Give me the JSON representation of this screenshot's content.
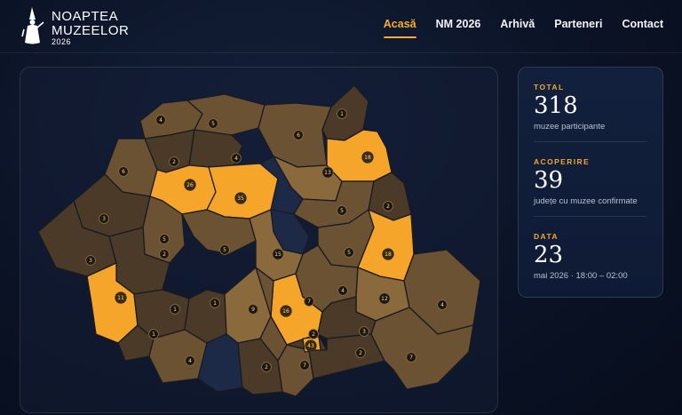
{
  "brand": {
    "line1": "NOAPTEA",
    "line2": "MUZEELOR",
    "year": "2026"
  },
  "nav": [
    {
      "label": "Acasă",
      "active": true
    },
    {
      "label": "NM 2026",
      "active": false
    },
    {
      "label": "Arhivă",
      "active": false
    },
    {
      "label": "Parteneri",
      "active": false
    },
    {
      "label": "Contact",
      "active": false
    }
  ],
  "stats": [
    {
      "label": "TOTAL",
      "value": "318",
      "desc": "muzee participante"
    },
    {
      "label": "ACOPERIRE",
      "value": "39",
      "desc": "județe cu muzee confirmate"
    },
    {
      "label": "DATA",
      "value": "23",
      "desc": "mai 2026 · 18:00 – 02:00"
    }
  ],
  "colors": {
    "accent": "#f6ad2d",
    "highlight": "#f5a62a",
    "low": "#4a3a27",
    "mid": "#6b5232",
    "high": "#8a6a3c"
  },
  "map": {
    "counties": [
      {
        "id": "SM",
        "count": "4",
        "tone": "mid"
      },
      {
        "id": "MM",
        "count": "5",
        "tone": "mid"
      },
      {
        "id": "SV",
        "count": "6",
        "tone": "mid"
      },
      {
        "id": "BT",
        "count": "1",
        "tone": "low"
      },
      {
        "id": "BH",
        "count": "6",
        "tone": "mid"
      },
      {
        "id": "SJ",
        "count": "2",
        "tone": "low"
      },
      {
        "id": "BN",
        "count": "4",
        "tone": "low"
      },
      {
        "id": "NT",
        "count": "13",
        "tone": "high"
      },
      {
        "id": "IS",
        "count": "18",
        "tone": "hl"
      },
      {
        "id": "CJ",
        "count": "26",
        "tone": "hl"
      },
      {
        "id": "MS",
        "count": "35",
        "tone": "hl"
      },
      {
        "id": "HR",
        "count": "",
        "tone": "empty"
      },
      {
        "id": "BC",
        "count": "5",
        "tone": "mid"
      },
      {
        "id": "VS",
        "count": "2",
        "tone": "low"
      },
      {
        "id": "AR",
        "count": "3",
        "tone": "low"
      },
      {
        "id": "AB",
        "count": "5",
        "tone": "mid"
      },
      {
        "id": "SB",
        "count": "5",
        "tone": "mid"
      },
      {
        "id": "CV",
        "count": "",
        "tone": "empty"
      },
      {
        "id": "VN",
        "count": "5",
        "tone": "mid"
      },
      {
        "id": "GL",
        "count": "18",
        "tone": "hl"
      },
      {
        "id": "TM",
        "count": "3",
        "tone": "low"
      },
      {
        "id": "HD",
        "count": "2",
        "tone": "low"
      },
      {
        "id": "BV",
        "count": "15",
        "tone": "high"
      },
      {
        "id": "CS",
        "count": "11",
        "tone": "hl"
      },
      {
        "id": "GJ",
        "count": "1",
        "tone": "low"
      },
      {
        "id": "VL",
        "count": "1",
        "tone": "low"
      },
      {
        "id": "AG",
        "count": "9",
        "tone": "high"
      },
      {
        "id": "PH",
        "count": "16",
        "tone": "hl"
      },
      {
        "id": "DB",
        "count": "7",
        "tone": "mid"
      },
      {
        "id": "BZ",
        "count": "4",
        "tone": "mid"
      },
      {
        "id": "BR",
        "count": "12",
        "tone": "high"
      },
      {
        "id": "TL",
        "count": "4",
        "tone": "mid"
      },
      {
        "id": "MH",
        "count": "1",
        "tone": "low"
      },
      {
        "id": "DJ",
        "count": "4",
        "tone": "mid"
      },
      {
        "id": "OT",
        "count": "",
        "tone": "empty"
      },
      {
        "id": "TR",
        "count": "2",
        "tone": "low"
      },
      {
        "id": "GR",
        "count": "7",
        "tone": "mid"
      },
      {
        "id": "IF",
        "count": "2",
        "tone": "low"
      },
      {
        "id": "B",
        "count": "43",
        "tone": "hl"
      },
      {
        "id": "IL",
        "count": "3",
        "tone": "low"
      },
      {
        "id": "CL",
        "count": "2",
        "tone": "low"
      },
      {
        "id": "CT",
        "count": "7",
        "tone": "mid"
      }
    ]
  }
}
